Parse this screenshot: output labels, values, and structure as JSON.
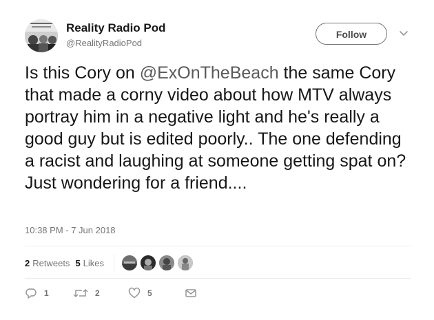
{
  "author": {
    "name": "Reality Radio Pod",
    "handle": "@RealityRadioPod",
    "follow_label": "Follow"
  },
  "tweet": {
    "text_before": "Is this Cory on ",
    "mention": "@ExOnTheBeach",
    "text_after": " the same Cory that made a corny video about how MTV always portray him in a negative light and he's really a good guy but is edited poorly.. The one defending a racist and laughing at someone getting spat on? Just wondering for a friend....",
    "timestamp": "10:38 PM - 7 Jun 2018"
  },
  "stats": {
    "retweets_count": "2",
    "retweets_label": "Retweets",
    "likes_count": "5",
    "likes_label": "Likes"
  },
  "actions": {
    "reply_count": "1",
    "retweet_count": "2",
    "like_count": "5"
  },
  "icons": {
    "reply": "reply-icon",
    "retweet": "retweet-icon",
    "like": "heart-icon",
    "dm": "envelope-icon",
    "menu": "chevron-down-icon"
  }
}
